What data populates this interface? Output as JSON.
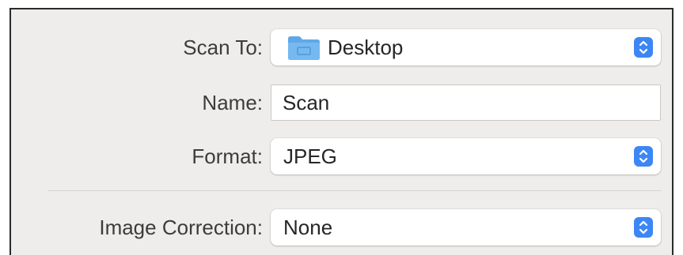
{
  "form": {
    "scan_to": {
      "label": "Scan To:",
      "value": "Desktop",
      "icon": "folder-icon"
    },
    "name": {
      "label": "Name:",
      "value": "Scan"
    },
    "format": {
      "label": "Format:",
      "value": "JPEG"
    },
    "image_correction": {
      "label": "Image Correction:",
      "value": "None"
    }
  },
  "colors": {
    "panel_background": "#efedec",
    "accent_stepper": "#3d87f5",
    "folder_icon": "#5fa8e8"
  }
}
